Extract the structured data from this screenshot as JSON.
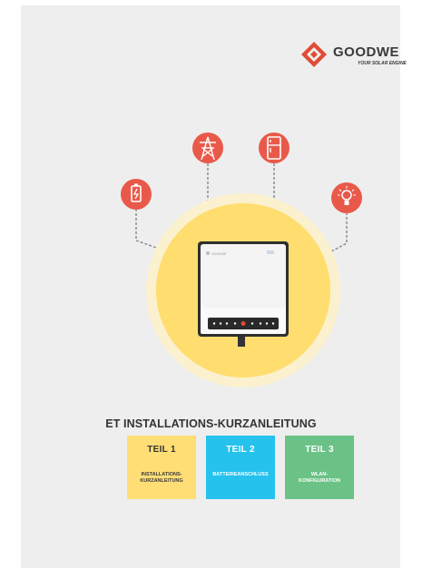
{
  "brand": {
    "name": "GOODWE",
    "tagline": "YOUR SOLAR ENGINE",
    "accent_color": "#e04b36",
    "inverter_label": "GOODWE"
  },
  "icons": [
    "battery-icon",
    "power-pylon-icon",
    "refrigerator-icon",
    "light-bulb-icon"
  ],
  "title": "ET INSTALLATIONS-KURZANLEITUNG",
  "parts": [
    {
      "label": "TEIL 1",
      "desc": "INSTALLATIONS-\nKURZANLEITUNG",
      "color": "#ffde76"
    },
    {
      "label": "TEIL 2",
      "desc": "BATTERIEANSCHLUSS",
      "color": "#25c2ee"
    },
    {
      "label": "TEIL 3",
      "desc": "WLAN-\nKONFIGURATION",
      "color": "#6ac287"
    }
  ]
}
